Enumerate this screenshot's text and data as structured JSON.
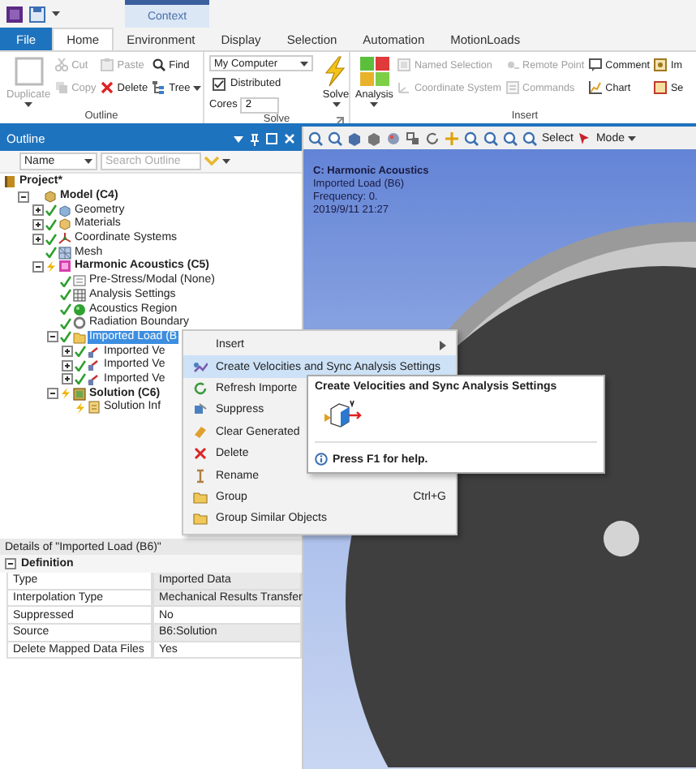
{
  "context_group": "Context",
  "tabs": [
    {
      "label": "File",
      "kind": "file",
      "selected": false
    },
    {
      "label": "Home",
      "kind": "tab",
      "selected": true
    },
    {
      "label": "Environment",
      "kind": "tab",
      "selected": false
    },
    {
      "label": "Display",
      "kind": "tab",
      "selected": false
    },
    {
      "label": "Selection",
      "kind": "tab",
      "selected": false
    },
    {
      "label": "Automation",
      "kind": "tab",
      "selected": false
    },
    {
      "label": "MotionLoads",
      "kind": "tab",
      "selected": false
    }
  ],
  "ribbon": [
    {
      "title": "Outline",
      "launcher": false,
      "columns": [
        [
          {
            "label": "Duplicate",
            "kind": "large",
            "disabled": true,
            "menu": true
          }
        ],
        [
          {
            "label": "Cut",
            "kind": "small",
            "disabled": true,
            "menu": false
          },
          {
            "label": "Copy",
            "kind": "small",
            "disabled": true,
            "menu": false
          }
        ],
        [
          {
            "label": "Paste",
            "kind": "small",
            "disabled": true,
            "menu": false
          },
          {
            "label": "Delete",
            "kind": "small",
            "disabled": false,
            "menu": false
          }
        ],
        [
          {
            "label": "Find",
            "kind": "small",
            "disabled": false,
            "menu": false
          },
          {
            "label": "Tree",
            "kind": "small",
            "disabled": false,
            "menu": true
          }
        ]
      ]
    },
    {
      "title": "Solve",
      "launcher": true,
      "columns": [
        [
          {
            "kind": "dropdown",
            "value": "My Computer"
          },
          {
            "kind": "checkbox",
            "label": "Distributed",
            "checked": true
          },
          {
            "kind": "field",
            "label": "Cores",
            "value": "2"
          }
        ],
        [
          {
            "label": "Solve",
            "kind": "large",
            "disabled": false,
            "menu": true
          }
        ]
      ]
    },
    {
      "title": "Insert",
      "launcher": false,
      "columns": [
        [
          {
            "label": "Analysis",
            "kind": "large",
            "disabled": false,
            "menu": true
          }
        ],
        [
          {
            "label": "Named Selection",
            "kind": "small",
            "disabled": true,
            "menu": false
          },
          {
            "label": "Coordinate System",
            "kind": "small",
            "disabled": true,
            "menu": false
          }
        ],
        [
          {
            "label": "Remote Point",
            "kind": "small",
            "disabled": true,
            "menu": false
          },
          {
            "label": "Commands",
            "kind": "small",
            "disabled": true,
            "menu": false
          }
        ],
        [
          {
            "label": "Comment",
            "kind": "small",
            "disabled": false,
            "menu": false
          },
          {
            "label": "Chart",
            "kind": "small",
            "disabled": false,
            "menu": false
          }
        ],
        [
          {
            "label": "Im",
            "kind": "small",
            "disabled": false,
            "menu": false
          },
          {
            "label": "Se",
            "kind": "small",
            "disabled": false,
            "menu": false
          }
        ]
      ]
    }
  ],
  "outline": {
    "title": "Outline",
    "filter": {
      "value": "Name"
    },
    "search": {
      "placeholder": "Search Outline"
    },
    "tree": [
      {
        "label": "Project*",
        "bold": true,
        "selected": false,
        "children": [
          {
            "label": "Model (C4)",
            "bold": true,
            "expanded": true,
            "selected": false,
            "children": [
              {
                "label": "Geometry",
                "bold": false,
                "done": true,
                "expanded": false,
                "selected": false
              },
              {
                "label": "Materials",
                "bold": false,
                "done": true,
                "expanded": false,
                "selected": false
              },
              {
                "label": "Coordinate Systems",
                "bold": false,
                "done": true,
                "expanded": false,
                "selected": false
              },
              {
                "label": "Mesh",
                "bold": false,
                "done": true,
                "selected": false
              },
              {
                "label": "Harmonic Acoustics (C5)",
                "bold": true,
                "done": false,
                "expanded": true,
                "selected": false,
                "children": [
                  {
                    "label": "Pre-Stress/Modal (None)",
                    "bold": false,
                    "done": true,
                    "selected": false
                  },
                  {
                    "label": "Analysis Settings",
                    "bold": false,
                    "done": true,
                    "selected": false
                  },
                  {
                    "label": "Acoustics Region",
                    "bold": false,
                    "done": true,
                    "selected": false
                  },
                  {
                    "label": "Radiation Boundary",
                    "bold": false,
                    "done": true,
                    "selected": false
                  },
                  {
                    "label": "Imported Load (B",
                    "bold": false,
                    "done": true,
                    "expanded": true,
                    "selected": true,
                    "children": [
                      {
                        "label": "Imported Ve",
                        "bold": false,
                        "done": true,
                        "expanded": false,
                        "selected": false
                      },
                      {
                        "label": "Imported Ve",
                        "bold": false,
                        "done": true,
                        "expanded": false,
                        "selected": false
                      },
                      {
                        "label": "Imported Ve",
                        "bold": false,
                        "done": true,
                        "expanded": false,
                        "selected": false
                      }
                    ]
                  },
                  {
                    "label": "Solution (C6)",
                    "bold": true,
                    "done": false,
                    "expanded": true,
                    "selected": false,
                    "children": [
                      {
                        "label": "Solution Inf",
                        "bold": false,
                        "done": false,
                        "selected": false
                      }
                    ]
                  }
                ]
              }
            ]
          }
        ]
      }
    ]
  },
  "details": {
    "title": "Details of \"Imported Load (B6)\"",
    "groups": [
      {
        "title": "Definition",
        "expanded": true,
        "rows": [
          {
            "label": "Type",
            "value": "Imported Data",
            "readonly": true
          },
          {
            "label": "Interpolation Type",
            "value": "Mechanical Results Transfer",
            "readonly": true
          },
          {
            "label": "Suppressed",
            "value": "No",
            "readonly": false
          },
          {
            "label": "Source",
            "value": "B6:Solution",
            "readonly": true
          },
          {
            "label": "Delete Mapped Data Files",
            "value": "Yes",
            "readonly": false
          }
        ]
      }
    ]
  },
  "viewport": {
    "toolbar": {
      "select": "Select",
      "mode": "Mode"
    },
    "overlay": {
      "title": "C: Harmonic Acoustics",
      "lines": [
        "Imported Load (B6)",
        "Frequency: 0.",
        "2019/9/11 21:27"
      ]
    }
  },
  "context_menu": {
    "items": [
      {
        "label": "Insert",
        "submenu": true,
        "selected": false
      },
      {
        "label": "Create Velocities and Sync Analysis Settings",
        "selected": true
      },
      {
        "label": "Refresh Importe",
        "selected": false
      },
      {
        "label": "Suppress",
        "selected": false
      },
      {
        "label": "Clear Generated",
        "selected": false
      },
      {
        "label": "Delete",
        "selected": false
      },
      {
        "label": "Rename",
        "selected": false
      },
      {
        "label": "Group",
        "shortcut": "Ctrl+G",
        "selected": false,
        "submenu": false
      },
      {
        "label": "Group Similar Objects",
        "selected": false
      }
    ]
  },
  "tooltip": {
    "title": "Create Velocities and Sync Analysis Settings",
    "help": "Press F1 for help."
  }
}
